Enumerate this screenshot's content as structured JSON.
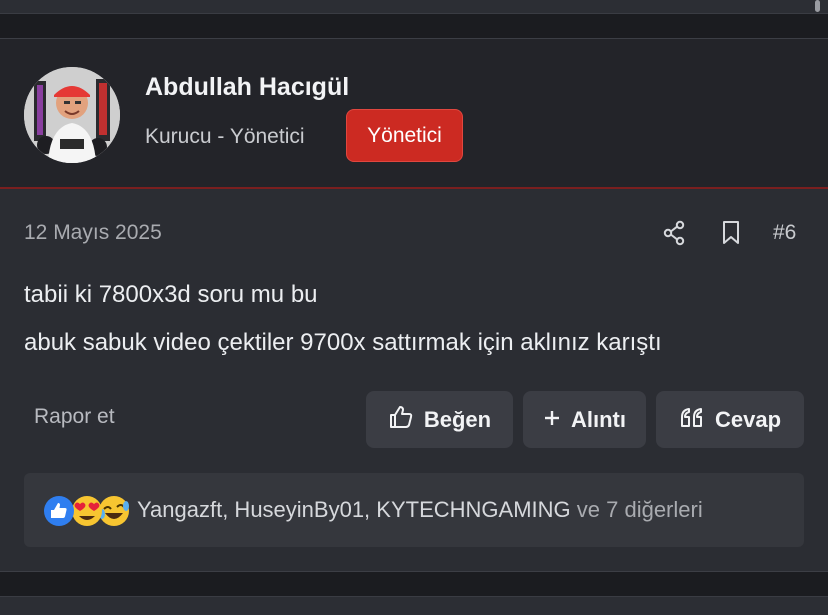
{
  "user": {
    "name": "Abdullah Hacıgül",
    "title": "Kurucu - Yönetici",
    "badge": "Yönetici"
  },
  "post": {
    "date": "12 Mayıs 2025",
    "number": "#6",
    "lines": [
      "tabii ki 7800x3d soru mu bu",
      "abuk sabuk video çektiler 9700x sattırmak için aklınız karıştı"
    ]
  },
  "actions": {
    "report": "Rapor et",
    "like": "Beğen",
    "quote": "Alıntı",
    "reply": "Cevap"
  },
  "reactions": {
    "icons": [
      "thumbs-up-icon",
      "heart-eyes-icon",
      "laughing-icon"
    ],
    "users": "Yangazft, HuseyinBy01, KYTECHNGAMING",
    "more": "ve 7 diğerleri"
  },
  "colors": {
    "badge": "#cc2a22",
    "accent_border": "#7a1f1f",
    "background": "#2b2d33",
    "header": "#232429",
    "button": "#3b3d44"
  }
}
